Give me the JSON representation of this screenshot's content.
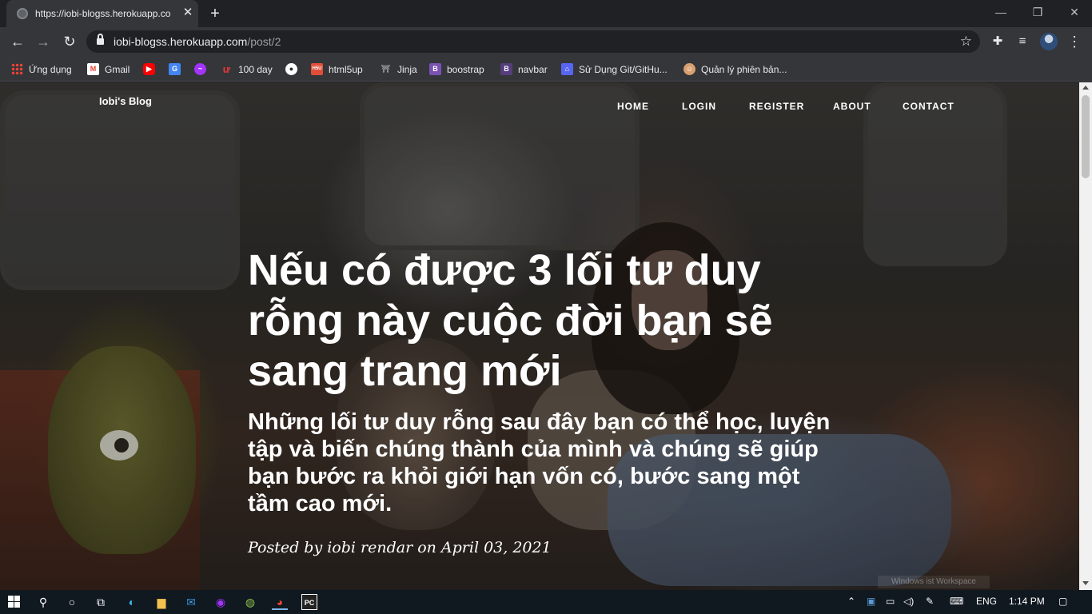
{
  "browser": {
    "tab": {
      "title": "https://iobi-blogss.herokuapp.co",
      "close_glyph": "✕"
    },
    "new_tab_glyph": "+",
    "window_controls": {
      "minimize": "—",
      "restore": "❐",
      "close": "✕"
    },
    "url": {
      "host": "iobi-blogss.herokuapp.com",
      "path": "/post/2"
    },
    "bookmarks": [
      {
        "label": "Ứng dụng",
        "icon": "apps-grid-icon",
        "color": "#e8eaed"
      },
      {
        "label": "Gmail",
        "icon": "gmail-icon",
        "color": "#ea4335"
      },
      {
        "label": "",
        "icon": "youtube-icon",
        "color": "#ff0000"
      },
      {
        "label": "",
        "icon": "translate-icon",
        "color": "#4285f4"
      },
      {
        "label": "",
        "icon": "messenger-icon",
        "color": "#a334fa"
      },
      {
        "label": "100 day",
        "icon": "hundred-day-icon",
        "color": "#e53935"
      },
      {
        "label": "",
        "icon": "github-icon",
        "color": "#ffffff"
      },
      {
        "label": "html5up",
        "icon": "html5up-icon",
        "color": "#e04e39"
      },
      {
        "label": "Jinja",
        "icon": "jinja-icon",
        "color": "#9e9e9e"
      },
      {
        "label": "boostrap",
        "icon": "bootstrap-icon",
        "color": "#7952b3"
      },
      {
        "label": "navbar",
        "icon": "navbar-icon",
        "color": "#563d7c"
      },
      {
        "label": "Sử Dụng Git/GitHu...",
        "icon": "git-icon",
        "color": "#5865f2"
      },
      {
        "label": "Quản lý phiên bản...",
        "icon": "git-book-icon",
        "color": "#d8a070"
      }
    ]
  },
  "site": {
    "brand": "Iobi's Blog",
    "nav": [
      "HOME",
      "LOGIN",
      "REGISTER",
      "ABOUT",
      "CONTACT"
    ]
  },
  "post": {
    "title": "Nếu có được 3 lối tư duy rỗng này cuộc đời bạn sẽ sang trang mới",
    "subtitle": "Những lối tư duy rỗng sau đây bạn có thể học, luyện tập và biến chúng thành của mình và chúng sẽ giúp bạn bước ra khỏi giới hạn vốn có, bước sang một tầm cao mới.",
    "meta": "Posted by iobi rendar on April 03, 2021"
  },
  "watermark": "Windows ist Workspace",
  "taskbar": {
    "language": "ENG",
    "time": "1:14 PM"
  }
}
